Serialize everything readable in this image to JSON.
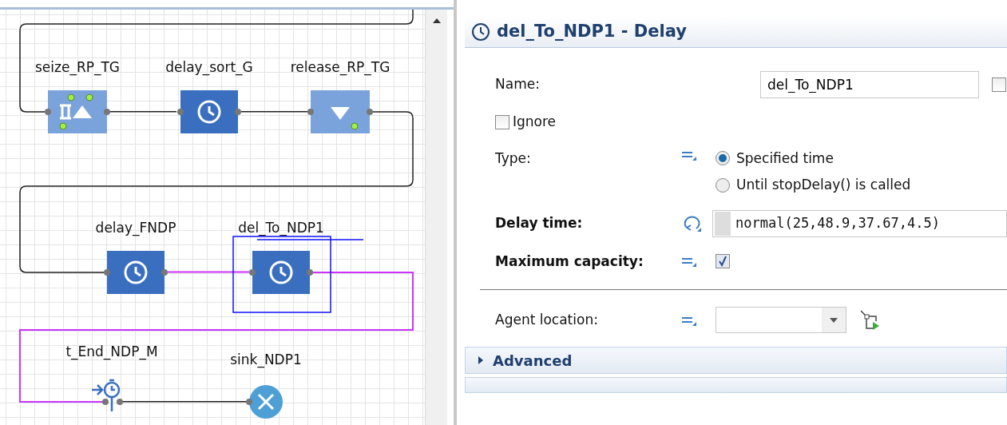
{
  "diagram": {
    "nodes": [
      {
        "label": "seize_RP_TG",
        "kind": "seize",
        "selected": false
      },
      {
        "label": "delay_sort_G",
        "kind": "delay",
        "selected": false
      },
      {
        "label": "release_RP_TG",
        "kind": "release",
        "selected": false
      },
      {
        "label": "delay_FNDP",
        "kind": "delay",
        "selected": false
      },
      {
        "label": "del_To_NDP1",
        "kind": "delay",
        "selected": true
      },
      {
        "label": "t_End_NDP_M",
        "kind": "time_end",
        "selected": false
      },
      {
        "label": "sink_NDP1",
        "kind": "sink",
        "selected": false
      }
    ],
    "connectors": [
      {
        "highlighted": false
      },
      {
        "highlighted": false
      },
      {
        "highlighted": false
      },
      {
        "highlighted": false
      },
      {
        "highlighted": true
      },
      {
        "highlighted": true
      },
      {
        "highlighted": false
      }
    ]
  },
  "properties": {
    "title": "del_To_NDP1 - Delay",
    "name": {
      "label": "Name:",
      "value": "del_To_NDP1"
    },
    "ignore": {
      "label": "Ignore",
      "checked": false
    },
    "type": {
      "label": "Type:",
      "options": [
        {
          "label": "Specified time",
          "selected": true
        },
        {
          "label": "Until stopDelay() is called",
          "selected": false
        }
      ]
    },
    "delay_time": {
      "label": "Delay time:",
      "value": "normal(25,48.9,37.67,4.5)"
    },
    "maximum_capacity": {
      "label": "Maximum capacity:",
      "checked": true
    },
    "agent_location": {
      "label": "Agent location:"
    },
    "sections": [
      {
        "label": "Advanced",
        "expanded": false
      }
    ]
  }
}
